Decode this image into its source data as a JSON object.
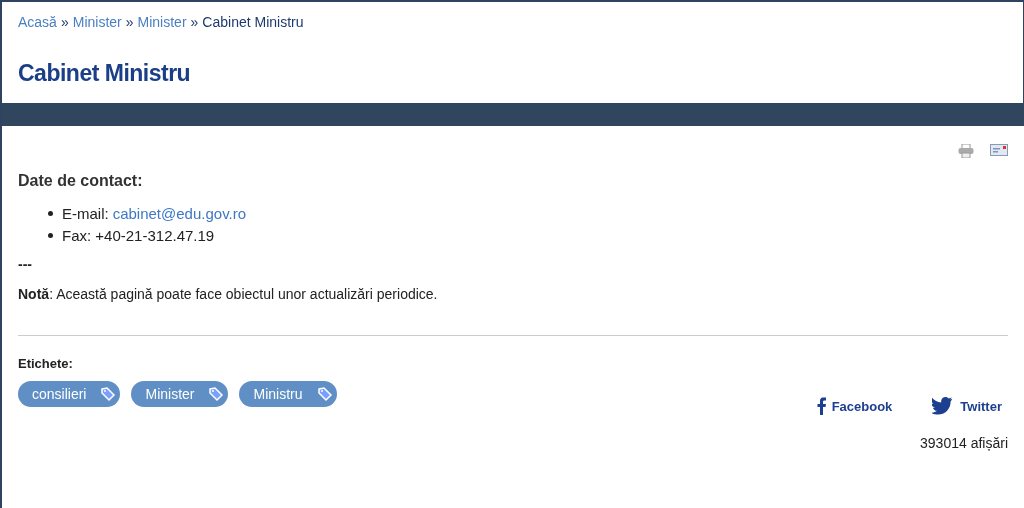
{
  "breadcrumb": [
    {
      "label": "Acasă",
      "current": false
    },
    {
      "label": "»",
      "kind": "sep"
    },
    {
      "label": "Minister",
      "current": false
    },
    {
      "label": "»",
      "kind": "sep"
    },
    {
      "label": "Minister",
      "current": false
    },
    {
      "label": "»",
      "kind": "sep"
    },
    {
      "label": "Cabinet Ministru",
      "current": true
    }
  ],
  "title": "Cabinet Ministru",
  "contact": {
    "heading": "Date de contact:",
    "items": [
      {
        "label": "E-mail:",
        "link": "cabinet@edu.gov.ro"
      },
      {
        "label": "Fax: +40-21-312.47.19"
      }
    ]
  },
  "separator": "---",
  "note": "**Notă**: Această pagină poate face obiectul unor actualizări periodice.",
  "tags": {
    "heading": "Etichete:",
    "items": [
      "consilieri",
      "Minister",
      "Ministru"
    ]
  },
  "share": [
    {
      "kind": "facebook",
      "label": "Facebook"
    },
    {
      "kind": "twitter",
      "label": "Twitter"
    }
  ],
  "views": "393014 afișări"
}
